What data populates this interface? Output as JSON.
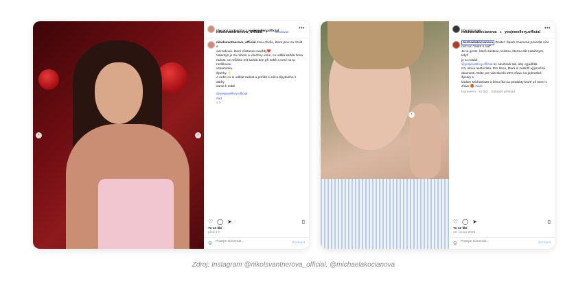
{
  "post1": {
    "username": "nikolsvantnerova_official",
    "follow": "Sledovat",
    "partnership_prefix": "Placené partnerství s",
    "partner": "yesjewellery.official",
    "caption_user": "nikolsvantnerova_official",
    "caption_lines": [
      "Jsou chvíle, které jsou na chvilt a",
      "ovk takové, které zůstanou navždy❤️",
      "Valentýn je za rohem a všechny víme, co udělá každá žena",
      "radost, ve můžete mít každá den při sobě a není na ta rozlišovou",
      "vzpomínku.",
      "Šperky ✨",
      "A nebo co si udělat radost a pořídit si něco třpytivého z dárky",
      "sama k sobě."
    ],
    "tag_mention": "@yesjewellery.official",
    "hashtag": "#ad",
    "meta": "4 h",
    "likes": "To se líbí",
    "date": "před 4 h",
    "comment_placeholder": "Přidejte komentář...",
    "post_label": "Zveřejnit"
  },
  "post2": {
    "username": "michaelakocianova",
    "with_word": "a",
    "coauthor": "yesjewellery.official",
    "location": "Původní zvuk",
    "caption_user": "michaelakocianova",
    "caption_first": "Znáte? Šperk znamená povedat více",
    "caption_lines": [
      "než tím \"mám ti rád\".",
      "Je to gesto, které zastave, krásou, kterou dát zasáhnym, když",
      "je tu nosáš."
    ],
    "caption_mention": "@yesjewellery.official",
    "caption_rest": [
      "sv navrhovli tak, aby vyjadřitla",
      "Co, slová nestočíktu. Pro ženu, která si zaslúží výjimočnú",
      "okamenti. Máte pre vás skvelú 20% zľavu na jednotlivé šperky s",
      "kódom Michaela20 a ženu ľba na produkty ktoré už nemí v",
      "zľave 🎁"
    ],
    "caption_hashtag": "#ads",
    "meta_time": "Upraveno · 10 týd.",
    "meta_translate": "Zobrazit překlad",
    "likes": "To se líbí",
    "date": "22. února 2025",
    "comment_placeholder": "Přidejte komentář...",
    "post_label": "Zveřejnit"
  },
  "footer_caption": "Zdroj: Instagram @nikolsvantnerova_official, @michaelakocianova",
  "icons": [
    "heart-icon",
    "comment-icon",
    "share-icon",
    "bookmark-icon",
    "emoji-icon",
    "more-icon",
    "verified-icon",
    "chevron-left-icon",
    "chevron-right-icon"
  ]
}
